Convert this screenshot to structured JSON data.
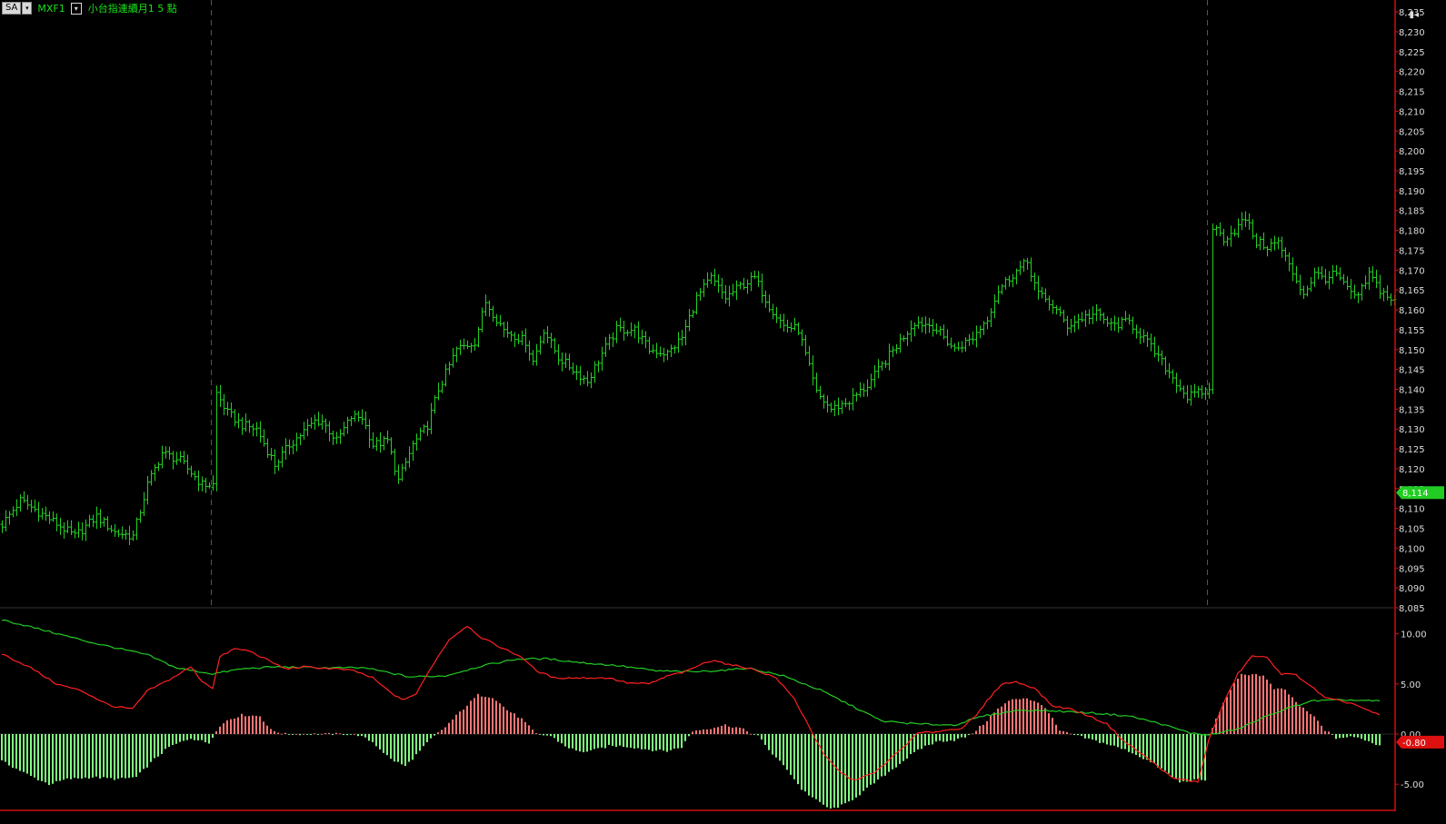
{
  "header": {
    "mode_button": "SA",
    "symbol": "MXF1",
    "instrument_name": "小台指連續月1 5 點"
  },
  "corner_label": "▮◂",
  "colors": {
    "background": "#000000",
    "bar": "#22d022",
    "axis": "#cc1111",
    "grid": "#555555",
    "macd_line": "#ff2020",
    "signal_line": "#22cc22",
    "hist_pos": "#ff7575",
    "hist_neg": "#80ff80"
  },
  "chart_data": [
    {
      "type": "ohlc",
      "ylim": [
        8085,
        8238
      ],
      "y_ticks": [
        "8,235",
        "8,230",
        "8,225",
        "8,220",
        "8,215",
        "8,210",
        "8,205",
        "8,200",
        "8,195",
        "8,190",
        "8,185",
        "8,180",
        "8,175",
        "8,170",
        "8,165",
        "8,160",
        "8,155",
        "8,150",
        "8,145",
        "8,140",
        "8,135",
        "8,130",
        "8,125",
        "8,120",
        "8,115",
        "8,110",
        "8,105",
        "8,100",
        "8,095",
        "8,090",
        "8,085"
      ],
      "last_value_label": "8,114",
      "session_breaks": [
        58,
        332
      ],
      "close_path": [
        [
          0,
          8106
        ],
        [
          5,
          8112
        ],
        [
          12,
          8108
        ],
        [
          20,
          8103
        ],
        [
          26,
          8108
        ],
        [
          31,
          8104
        ],
        [
          36,
          8103
        ],
        [
          40,
          8116
        ],
        [
          44,
          8124
        ],
        [
          49,
          8122
        ],
        [
          55,
          8116
        ],
        [
          58,
          8116
        ],
        [
          59,
          8139
        ],
        [
          62,
          8134
        ],
        [
          66,
          8131
        ],
        [
          70,
          8130
        ],
        [
          75,
          8121
        ],
        [
          79,
          8126
        ],
        [
          86,
          8132
        ],
        [
          88,
          8132
        ],
        [
          92,
          8127
        ],
        [
          96,
          8133
        ],
        [
          99,
          8133
        ],
        [
          102,
          8126
        ],
        [
          106,
          8127
        ],
        [
          109,
          8117
        ],
        [
          113,
          8126
        ],
        [
          117,
          8131
        ],
        [
          120,
          8140
        ],
        [
          125,
          8150
        ],
        [
          130,
          8152
        ],
        [
          133,
          8162
        ],
        [
          138,
          8155
        ],
        [
          144,
          8152
        ],
        [
          146,
          8147
        ],
        [
          149,
          8155
        ],
        [
          153,
          8148
        ],
        [
          157,
          8145
        ],
        [
          161,
          8142
        ],
        [
          165,
          8149
        ],
        [
          169,
          8155
        ],
        [
          174,
          8155
        ],
        [
          178,
          8150
        ],
        [
          183,
          8149
        ],
        [
          187,
          8153
        ],
        [
          191,
          8163
        ],
        [
          195,
          8168
        ],
        [
          199,
          8163
        ],
        [
          203,
          8166
        ],
        [
          207,
          8168
        ],
        [
          211,
          8161
        ],
        [
          215,
          8156
        ],
        [
          219,
          8155
        ],
        [
          224,
          8139
        ],
        [
          228,
          8135
        ],
        [
          233,
          8137
        ],
        [
          238,
          8141
        ],
        [
          242,
          8146
        ],
        [
          246,
          8151
        ],
        [
          251,
          8157
        ],
        [
          256,
          8156
        ],
        [
          262,
          8150
        ],
        [
          267,
          8153
        ],
        [
          271,
          8158
        ],
        [
          274,
          8165
        ],
        [
          278,
          8169
        ],
        [
          282,
          8172
        ],
        [
          285,
          8164
        ],
        [
          289,
          8161
        ],
        [
          293,
          8156
        ],
        [
          297,
          8158
        ],
        [
          301,
          8159
        ],
        [
          305,
          8156
        ],
        [
          310,
          8157
        ],
        [
          314,
          8153
        ],
        [
          318,
          8148
        ],
        [
          322,
          8143
        ],
        [
          326,
          8138
        ],
        [
          329,
          8139
        ],
        [
          332,
          8140
        ],
        [
          333,
          8181
        ],
        [
          336,
          8178
        ],
        [
          339,
          8180
        ],
        [
          342,
          8183
        ],
        [
          345,
          8177
        ],
        [
          348,
          8176
        ],
        [
          351,
          8177
        ],
        [
          354,
          8171
        ],
        [
          358,
          8164
        ],
        [
          361,
          8169
        ],
        [
          364,
          8168
        ],
        [
          367,
          8169
        ],
        [
          370,
          8165
        ],
        [
          373,
          8163
        ],
        [
          376,
          8169
        ],
        [
          379,
          8165
        ],
        [
          383,
          8162
        ]
      ]
    },
    {
      "type": "macd",
      "ylim": [
        -7.7,
        12.5
      ],
      "y_ticks": [
        "10.00",
        "5.00",
        "0.00",
        "-5.00"
      ],
      "last_value_label": "-0.80",
      "hist_path": [
        [
          0,
          -2.7
        ],
        [
          8,
          -4.2
        ],
        [
          13,
          -5.0
        ],
        [
          18,
          -4.5
        ],
        [
          25,
          -4.3
        ],
        [
          32,
          -4.5
        ],
        [
          37,
          -4.3
        ],
        [
          42,
          -2.5
        ],
        [
          46,
          -1.3
        ],
        [
          52,
          -0.4
        ],
        [
          57,
          -0.9
        ],
        [
          59,
          0.4
        ],
        [
          62,
          1.4
        ],
        [
          66,
          1.9
        ],
        [
          71,
          1.8
        ],
        [
          74,
          0.4
        ],
        [
          78,
          0.0
        ],
        [
          86,
          0.0
        ],
        [
          90,
          0.0
        ],
        [
          94,
          0.0
        ],
        [
          98,
          -0.1
        ],
        [
          102,
          -0.8
        ],
        [
          107,
          -2.5
        ],
        [
          111,
          -3.2
        ],
        [
          115,
          -1.7
        ],
        [
          118,
          -0.5
        ],
        [
          122,
          0.7
        ],
        [
          126,
          2.2
        ],
        [
          131,
          3.9
        ],
        [
          135,
          3.7
        ],
        [
          139,
          2.4
        ],
        [
          143,
          1.5
        ],
        [
          147,
          0.0
        ],
        [
          151,
          -0.2
        ],
        [
          155,
          -1.2
        ],
        [
          159,
          -1.8
        ],
        [
          163,
          -1.6
        ],
        [
          167,
          -1.2
        ],
        [
          171,
          -1.2
        ],
        [
          175,
          -1.4
        ],
        [
          179,
          -1.6
        ],
        [
          183,
          -1.7
        ],
        [
          187,
          -1.3
        ],
        [
          190,
          0.3
        ],
        [
          195,
          0.6
        ],
        [
          199,
          0.9
        ],
        [
          203,
          0.6
        ],
        [
          208,
          -0.2
        ],
        [
          212,
          -2.0
        ],
        [
          216,
          -3.5
        ],
        [
          220,
          -5.5
        ],
        [
          224,
          -6.6
        ],
        [
          228,
          -7.5
        ],
        [
          232,
          -7.0
        ],
        [
          236,
          -6.0
        ],
        [
          241,
          -4.6
        ],
        [
          245,
          -3.5
        ],
        [
          250,
          -2.1
        ],
        [
          254,
          -1.2
        ],
        [
          258,
          -0.7
        ],
        [
          262,
          -0.6
        ],
        [
          266,
          -0.2
        ],
        [
          270,
          1.0
        ],
        [
          274,
          2.5
        ],
        [
          278,
          3.5
        ],
        [
          282,
          3.6
        ],
        [
          287,
          2.7
        ],
        [
          291,
          0.3
        ],
        [
          295,
          -0.1
        ],
        [
          300,
          -0.6
        ],
        [
          305,
          -1.1
        ],
        [
          310,
          -1.7
        ],
        [
          315,
          -2.6
        ],
        [
          320,
          -3.7
        ],
        [
          324,
          -4.8
        ],
        [
          328,
          -4.6
        ],
        [
          331,
          -4.6
        ],
        [
          332,
          -0.2
        ],
        [
          335,
          2.3
        ],
        [
          338,
          4.5
        ],
        [
          341,
          5.9
        ],
        [
          344,
          6.0
        ],
        [
          347,
          5.8
        ],
        [
          350,
          4.5
        ],
        [
          353,
          4.4
        ],
        [
          357,
          2.8
        ],
        [
          361,
          1.7
        ],
        [
          364,
          0.4
        ],
        [
          367,
          -0.4
        ],
        [
          371,
          -0.3
        ],
        [
          374,
          -0.4
        ],
        [
          377,
          -0.9
        ],
        [
          379,
          -1.1
        ]
      ],
      "macd_path": [
        [
          0,
          8.0
        ],
        [
          8,
          6.6
        ],
        [
          15,
          5.0
        ],
        [
          22,
          4.3
        ],
        [
          30,
          2.8
        ],
        [
          36,
          2.5
        ],
        [
          40,
          4.3
        ],
        [
          46,
          5.4
        ],
        [
          52,
          6.7
        ],
        [
          55,
          5.3
        ],
        [
          58,
          4.6
        ],
        [
          60,
          7.7
        ],
        [
          64,
          8.5
        ],
        [
          68,
          8.3
        ],
        [
          73,
          7.4
        ],
        [
          78,
          6.5
        ],
        [
          83,
          6.7
        ],
        [
          87,
          6.6
        ],
        [
          92,
          6.5
        ],
        [
          97,
          6.3
        ],
        [
          102,
          5.6
        ],
        [
          106,
          4.4
        ],
        [
          110,
          3.4
        ],
        [
          114,
          4.0
        ],
        [
          118,
          6.6
        ],
        [
          123,
          9.4
        ],
        [
          128,
          10.8
        ],
        [
          132,
          9.6
        ],
        [
          138,
          8.5
        ],
        [
          143,
          7.7
        ],
        [
          147,
          6.3
        ],
        [
          152,
          5.6
        ],
        [
          157,
          5.6
        ],
        [
          162,
          5.6
        ],
        [
          167,
          5.6
        ],
        [
          172,
          5.1
        ],
        [
          178,
          5.0
        ],
        [
          184,
          5.9
        ],
        [
          188,
          6.2
        ],
        [
          192,
          6.9
        ],
        [
          196,
          7.4
        ],
        [
          200,
          6.9
        ],
        [
          204,
          6.7
        ],
        [
          208,
          6.3
        ],
        [
          213,
          5.6
        ],
        [
          218,
          3.5
        ],
        [
          222,
          0.8
        ],
        [
          226,
          -2.0
        ],
        [
          230,
          -3.6
        ],
        [
          234,
          -4.6
        ],
        [
          240,
          -3.9
        ],
        [
          244,
          -2.6
        ],
        [
          248,
          -1.3
        ],
        [
          252,
          0.1
        ],
        [
          256,
          0.2
        ],
        [
          260,
          0.4
        ],
        [
          264,
          0.6
        ],
        [
          268,
          1.8
        ],
        [
          271,
          3.3
        ],
        [
          275,
          5.0
        ],
        [
          279,
          5.2
        ],
        [
          284,
          4.6
        ],
        [
          289,
          2.8
        ],
        [
          294,
          2.5
        ],
        [
          299,
          1.8
        ],
        [
          304,
          1.0
        ],
        [
          309,
          -0.8
        ],
        [
          314,
          -2.1
        ],
        [
          318,
          -3.2
        ],
        [
          322,
          -4.4
        ],
        [
          326,
          -4.6
        ],
        [
          329,
          -4.8
        ],
        [
          332,
          -0.6
        ],
        [
          336,
          3.0
        ],
        [
          340,
          6.0
        ],
        [
          344,
          7.8
        ],
        [
          348,
          7.6
        ],
        [
          352,
          6.0
        ],
        [
          356,
          5.9
        ],
        [
          360,
          4.8
        ],
        [
          364,
          3.6
        ],
        [
          368,
          3.3
        ],
        [
          372,
          3.0
        ],
        [
          376,
          2.3
        ],
        [
          379,
          1.9
        ]
      ],
      "signal_path": [
        [
          0,
          11.4
        ],
        [
          10,
          10.5
        ],
        [
          25,
          9.1
        ],
        [
          40,
          7.9
        ],
        [
          48,
          6.6
        ],
        [
          58,
          6.0
        ],
        [
          66,
          6.5
        ],
        [
          75,
          6.7
        ],
        [
          90,
          6.6
        ],
        [
          100,
          6.6
        ],
        [
          112,
          5.7
        ],
        [
          122,
          5.8
        ],
        [
          132,
          6.8
        ],
        [
          142,
          7.5
        ],
        [
          150,
          7.5
        ],
        [
          160,
          7.1
        ],
        [
          170,
          6.8
        ],
        [
          180,
          6.3
        ],
        [
          190,
          6.2
        ],
        [
          200,
          6.4
        ],
        [
          205,
          6.6
        ],
        [
          215,
          5.8
        ],
        [
          225,
          4.4
        ],
        [
          235,
          2.6
        ],
        [
          242,
          1.3
        ],
        [
          252,
          1.0
        ],
        [
          262,
          0.9
        ],
        [
          270,
          1.8
        ],
        [
          280,
          2.4
        ],
        [
          290,
          2.3
        ],
        [
          300,
          2.1
        ],
        [
          310,
          1.8
        ],
        [
          318,
          1.1
        ],
        [
          327,
          0.1
        ],
        [
          332,
          -0.1
        ],
        [
          340,
          0.5
        ],
        [
          350,
          2.1
        ],
        [
          360,
          3.3
        ],
        [
          370,
          3.4
        ],
        [
          377,
          3.3
        ]
      ]
    }
  ]
}
